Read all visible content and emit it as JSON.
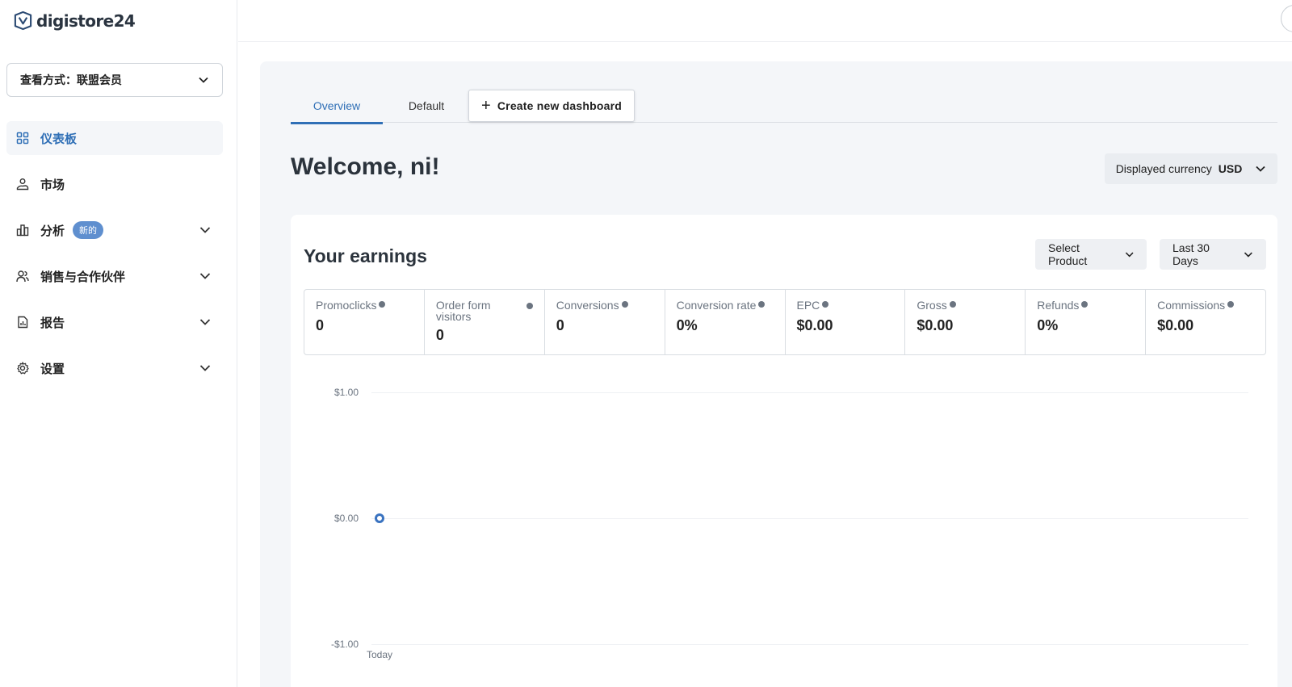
{
  "sidebar": {
    "logo_text": "digistore24",
    "view_select_label": "查看方式：联盟会员",
    "items": [
      {
        "label": "仪表板",
        "icon": "grid-icon",
        "active": true
      },
      {
        "label": "市场",
        "icon": "market-icon"
      },
      {
        "label": "分析",
        "icon": "bar-chart-icon",
        "badge": "新的",
        "expandable": true
      },
      {
        "label": "销售与合作伙伴",
        "icon": "users-icon",
        "expandable": true
      },
      {
        "label": "报告",
        "icon": "report-icon",
        "expandable": true
      },
      {
        "label": "设置",
        "icon": "gear-icon",
        "expandable": true
      }
    ]
  },
  "tabs": {
    "overview": "Overview",
    "default": "Default",
    "create": "Create new dashboard"
  },
  "welcome": "Welcome, ni!",
  "currency": {
    "label": "Displayed currency",
    "value": "USD"
  },
  "earnings": {
    "title": "Your earnings",
    "select_product": "Select Product",
    "date_range": "Last 30 Days",
    "metrics": [
      {
        "label": "Promoclicks",
        "value": "0"
      },
      {
        "label": "Order form visitors",
        "value": "0"
      },
      {
        "label": "Conversions",
        "value": "0"
      },
      {
        "label": "Conversion rate",
        "value": "0%"
      },
      {
        "label": "EPC",
        "value": "$0.00"
      },
      {
        "label": "Gross",
        "value": "$0.00"
      },
      {
        "label": "Refunds",
        "value": "0%"
      },
      {
        "label": "Commissions",
        "value": "$0.00"
      }
    ]
  },
  "chart_data": {
    "type": "line",
    "x": [
      "Today"
    ],
    "series": [
      {
        "values": [
          0
        ]
      }
    ],
    "y_ticks": [
      "$1.00",
      "$0.00",
      "-$1.00"
    ],
    "ylim": [
      -1,
      1
    ],
    "x_ticks": [
      "Today"
    ],
    "grid": true,
    "color": "#3a73c0"
  }
}
